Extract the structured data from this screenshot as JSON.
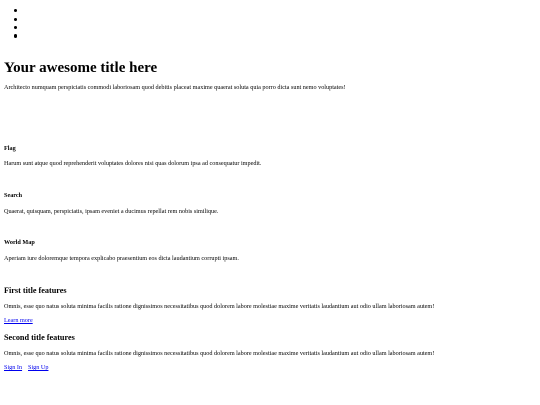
{
  "nav": {
    "items": [
      "",
      "",
      "",
      ""
    ]
  },
  "hero": {
    "title": "Your awesome title here",
    "text": "Architecto numquam perspiciatis commodi laboriosam quod debitis placeat maxime quaerat soluta quia porro dicta sunt nemo voluptates!"
  },
  "features": [
    {
      "heading": "Flag",
      "text": "Harum sunt atque quod reprehenderit voluptates dolores nisi quas dolorum ipsa ad consequatur impedit."
    },
    {
      "heading": "Search",
      "text": "Quaerat, quisquam, perspiciatis, ipsam eveniet a ducimus repellat rem nobis similique."
    },
    {
      "heading": "World Map",
      "text": "Aperiam iure doloremque tempora explicabo praesentium eos dicta laudantium corrupti ipsam."
    }
  ],
  "cards": [
    {
      "title": "First title features",
      "text": "Omnis, esse quo natus soluta minima facilis ratione dignissimos necessitatibus quod dolorem labore molestiae maxime veritatis laudantium aut odio ullam laboriosam autem!",
      "link": "Learn more"
    },
    {
      "title": "Second title features",
      "text": "Omnis, esse quo natus soluta minima facilis ratione dignissimos necessitatibus quod dolorem labore molestiae maxime veritatis laudantium aut odio ullam laboriosam autem!"
    }
  ],
  "auth": {
    "sign_in": "Sign In",
    "sign_up": "Sign Up"
  }
}
